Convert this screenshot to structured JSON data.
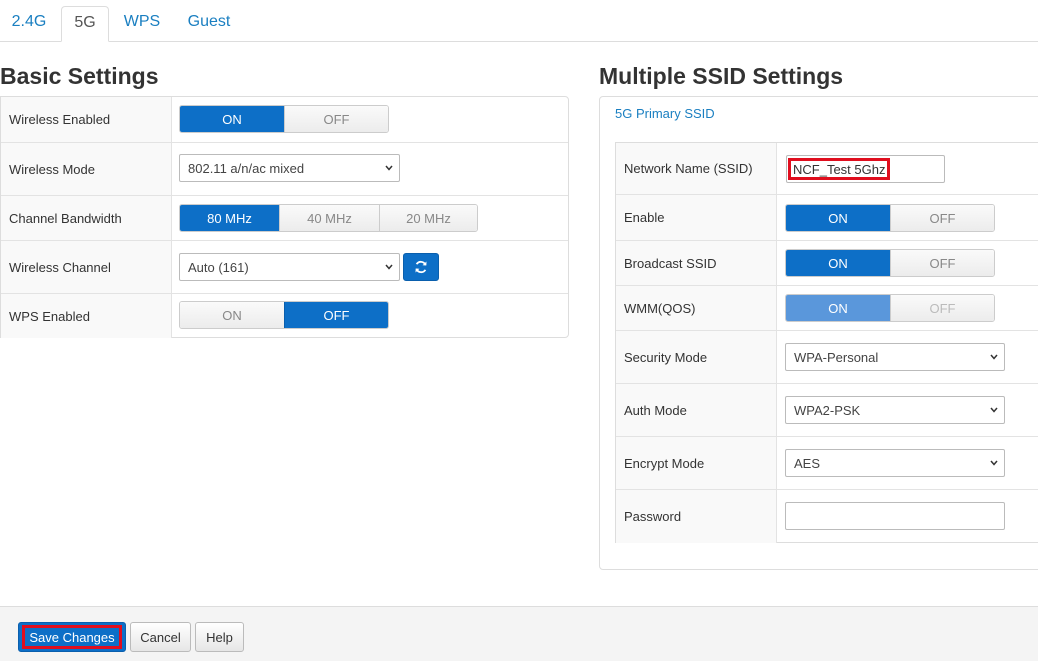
{
  "tabs": [
    "2.4G",
    "5G",
    "WPS",
    "Guest"
  ],
  "active_tab": "5G",
  "basic": {
    "title": "Basic Settings",
    "wireless_enabled": {
      "label": "Wireless Enabled",
      "on": "ON",
      "off": "OFF",
      "value": "ON"
    },
    "wireless_mode": {
      "label": "Wireless Mode",
      "value": "802.11 a/n/ac mixed"
    },
    "channel_bandwidth": {
      "label": "Channel Bandwidth",
      "options": [
        "80 MHz",
        "40 MHz",
        "20 MHz"
      ],
      "value": "80 MHz"
    },
    "wireless_channel": {
      "label": "Wireless Channel",
      "value": "Auto (161)"
    },
    "wps_enabled": {
      "label": "WPS Enabled",
      "on": "ON",
      "off": "OFF",
      "value": "OFF"
    }
  },
  "ssid": {
    "title": "Multiple SSID Settings",
    "tab": "5G Primary SSID",
    "network_name": {
      "label": "Network Name (SSID)",
      "value": "NCF_Test 5Ghz"
    },
    "enable": {
      "label": "Enable",
      "on": "ON",
      "off": "OFF",
      "value": "ON"
    },
    "broadcast": {
      "label": "Broadcast SSID",
      "on": "ON",
      "off": "OFF",
      "value": "ON"
    },
    "wmm": {
      "label": "WMM(QOS)",
      "on": "ON",
      "off": "OFF",
      "value": "ON",
      "disabled": true
    },
    "security_mode": {
      "label": "Security Mode",
      "value": "WPA-Personal"
    },
    "auth_mode": {
      "label": "Auth Mode",
      "value": "WPA2-PSK"
    },
    "encrypt_mode": {
      "label": "Encrypt Mode",
      "value": "AES"
    },
    "password": {
      "label": "Password",
      "value": ""
    }
  },
  "footer": {
    "save": "Save Changes",
    "cancel": "Cancel",
    "help": "Help"
  },
  "colors": {
    "accent": "#0d6fc7",
    "link": "#1a7fc1",
    "highlight": "#e00e1e"
  }
}
